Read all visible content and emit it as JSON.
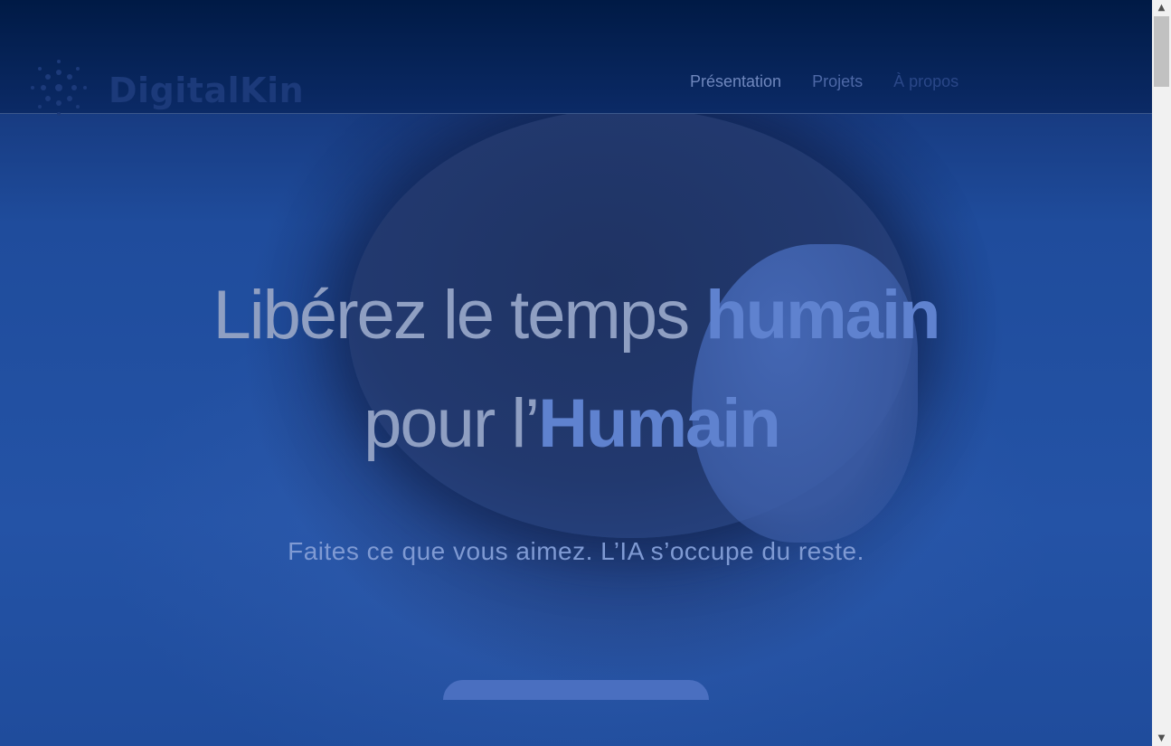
{
  "header": {
    "brand": "DigitalKin",
    "nav": [
      {
        "label": "Présentation"
      },
      {
        "label": "Projets"
      },
      {
        "label": "À propos"
      }
    ]
  },
  "hero": {
    "line1_light": "Libérez le temps ",
    "line1_bold": "humain",
    "line2_light": "pour l’",
    "line2_bold": "Humain",
    "subtitle": "Faites ce que vous aimez. L’IA s’occupe du reste."
  },
  "scrollbar": {
    "up_icon": "▲",
    "down_icon": "▼"
  },
  "colors": {
    "background": "#1f4c9c",
    "header": "#001a45",
    "accent": "#5f82cf"
  }
}
